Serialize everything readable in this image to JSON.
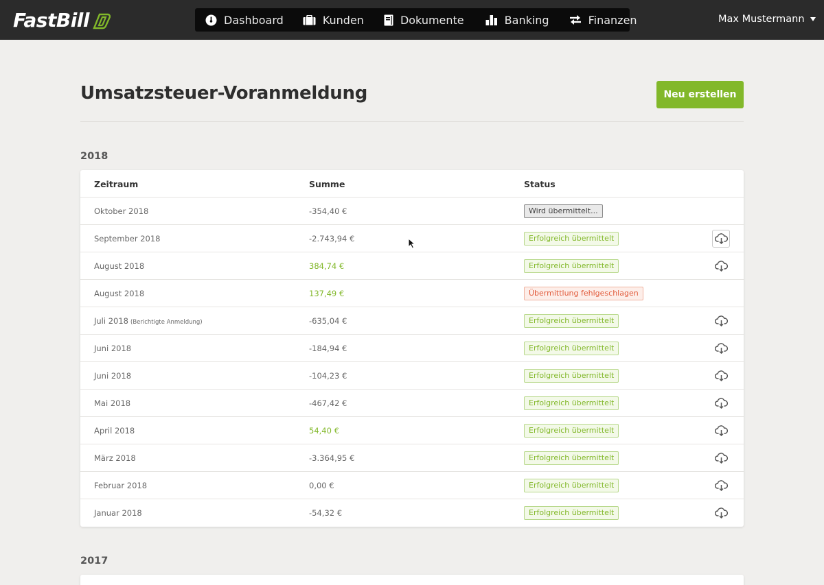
{
  "app": {
    "logo": "FastBill"
  },
  "nav": {
    "items": [
      {
        "label": "Dashboard",
        "icon": "dashboard-icon"
      },
      {
        "label": "Kunden",
        "icon": "briefcase-icon"
      },
      {
        "label": "Dokumente",
        "icon": "document-icon"
      },
      {
        "label": "Banking",
        "icon": "bar-chart-icon"
      },
      {
        "label": "Finanzen",
        "icon": "transfer-arrows-icon"
      }
    ]
  },
  "user": {
    "name": "Max Mustermann"
  },
  "page": {
    "title": "Umsatzsteuer-Voranmeldung",
    "new_button": "Neu erstellen"
  },
  "table_headers": {
    "period": "Zeitraum",
    "sum": "Summe",
    "status": "Status"
  },
  "sections": [
    {
      "year": "2018",
      "rows": [
        {
          "period": "Oktober 2018",
          "note": "",
          "sum": "-354,40 €",
          "status": "Wird übermittelt...",
          "status_type": "pending",
          "download": false
        },
        {
          "period": "September 2018",
          "note": "",
          "sum": "-2.743,94 €",
          "status": "Erfolgreich übermittelt",
          "status_type": "ok",
          "download": true,
          "download_active": true
        },
        {
          "period": "August 2018",
          "note": "",
          "sum": "384,74 €",
          "status": "Erfolgreich übermittelt",
          "status_type": "ok",
          "download": true
        },
        {
          "period": "August 2018",
          "note": "",
          "sum": "137,49 €",
          "status": "Übermittlung fehlgeschlagen",
          "status_type": "fail",
          "download": false
        },
        {
          "period": "Juli 2018",
          "note": "(Berichtigte Anmeldung)",
          "sum": "-635,04 €",
          "status": "Erfolgreich übermittelt",
          "status_type": "ok",
          "download": true
        },
        {
          "period": "Juni 2018",
          "note": "",
          "sum": "-184,94 €",
          "status": "Erfolgreich übermittelt",
          "status_type": "ok",
          "download": true
        },
        {
          "period": "Juni 2018",
          "note": "",
          "sum": "-104,23 €",
          "status": "Erfolgreich übermittelt",
          "status_type": "ok",
          "download": true
        },
        {
          "period": "Mai 2018",
          "note": "",
          "sum": "-467,42 €",
          "status": "Erfolgreich übermittelt",
          "status_type": "ok",
          "download": true
        },
        {
          "period": "April 2018",
          "note": "",
          "sum": "54,40 €",
          "status": "Erfolgreich übermittelt",
          "status_type": "ok",
          "download": true
        },
        {
          "period": "März 2018",
          "note": "",
          "sum": "-3.364,95 €",
          "status": "Erfolgreich übermittelt",
          "status_type": "ok",
          "download": true
        },
        {
          "period": "Februar 2018",
          "note": "",
          "sum": "0,00 €",
          "status": "Erfolgreich übermittelt",
          "status_type": "ok",
          "download": true
        },
        {
          "period": "Januar 2018",
          "note": "",
          "sum": "-54,32 €",
          "status": "Erfolgreich übermittelt",
          "status_type": "ok",
          "download": true
        }
      ]
    },
    {
      "year": "2017",
      "rows": []
    }
  ],
  "colors": {
    "accent": "#82b82a",
    "topbar": "#2b2b2b",
    "nav": "#0b0b0b",
    "error": "#e15a3a"
  }
}
